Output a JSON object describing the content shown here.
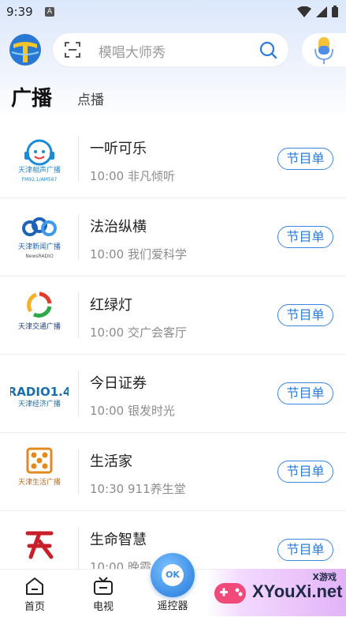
{
  "status_bar": {
    "time": "9:39",
    "notif_letter": "A"
  },
  "search": {
    "placeholder": "模唱大师秀"
  },
  "tabs": {
    "main": "广播",
    "secondary": "点播"
  },
  "stations": [
    {
      "name": "一听可乐",
      "program": "10:00  非凡倾听",
      "button": "节目单",
      "logo_name": "天津相声广播",
      "logo_sub": "FM92.1/AM567",
      "logo_color": "#1a8bd6"
    },
    {
      "name": "法治纵横",
      "program": "10:00  我们爱科学",
      "button": "节目单",
      "logo_name": "天津新闻广播",
      "logo_sub": "NewsRADIO",
      "logo_color": "#1d63b8"
    },
    {
      "name": "红绿灯",
      "program": "10:00  交广会客厅",
      "button": "节目单",
      "logo_name": "天津交通广播",
      "logo_sub": "",
      "logo_color": "#1d3f8a"
    },
    {
      "name": "今日证券",
      "program": "10:00  银发时光",
      "button": "节目单",
      "logo_name": "天津经济广播",
      "logo_sub": "RADIO1.4",
      "logo_color": "#1b6fa8"
    },
    {
      "name": "生活家",
      "program": "10:30  911养生堂",
      "button": "节目单",
      "logo_name": "天津生活广播",
      "logo_sub": "",
      "logo_color": "#e28a1e"
    },
    {
      "name": "生命智慧",
      "program": "10:00  晚霞",
      "button": "节目单",
      "logo_name": "",
      "logo_sub": "",
      "logo_color": "#c7202a"
    }
  ],
  "bottom_nav": {
    "home": "首页",
    "tv": "电视",
    "remote": "遥控器",
    "remote_ok": "OK"
  },
  "watermark": {
    "site": "XYouXi.net",
    "tag": "X游戏"
  },
  "colors": {
    "accent": "#2d7bd9",
    "header_bg": "#dbe7fb"
  }
}
